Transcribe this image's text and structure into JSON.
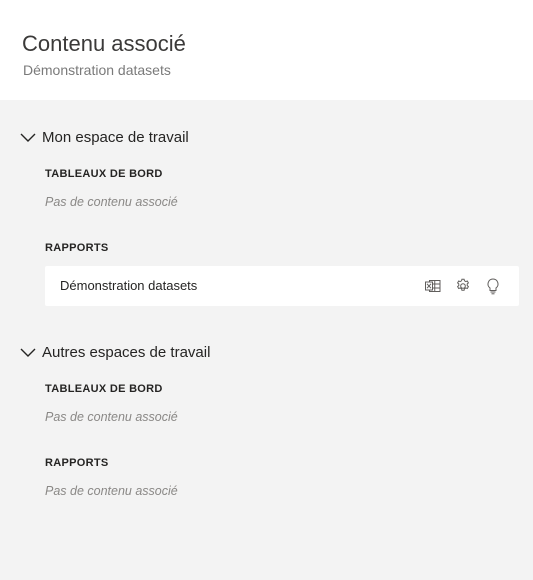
{
  "header": {
    "title": "Contenu associé",
    "subtitle": "Démonstration datasets"
  },
  "sections": [
    {
      "label": "Mon espace de travail",
      "dashboards": {
        "label": "TABLEAUX DE BORD",
        "empty": "Pas de contenu associé"
      },
      "reports": {
        "label": "RAPPORTS",
        "items": [
          {
            "name": "Démonstration datasets",
            "actions": [
              "excel-analyze-icon",
              "settings-gear-icon",
              "insights-lightbulb-icon"
            ]
          }
        ]
      }
    },
    {
      "label": "Autres espaces de travail",
      "dashboards": {
        "label": "TABLEAUX DE BORD",
        "empty": "Pas de contenu associé"
      },
      "reports": {
        "label": "RAPPORTS",
        "empty": "Pas de contenu associé"
      }
    }
  ]
}
